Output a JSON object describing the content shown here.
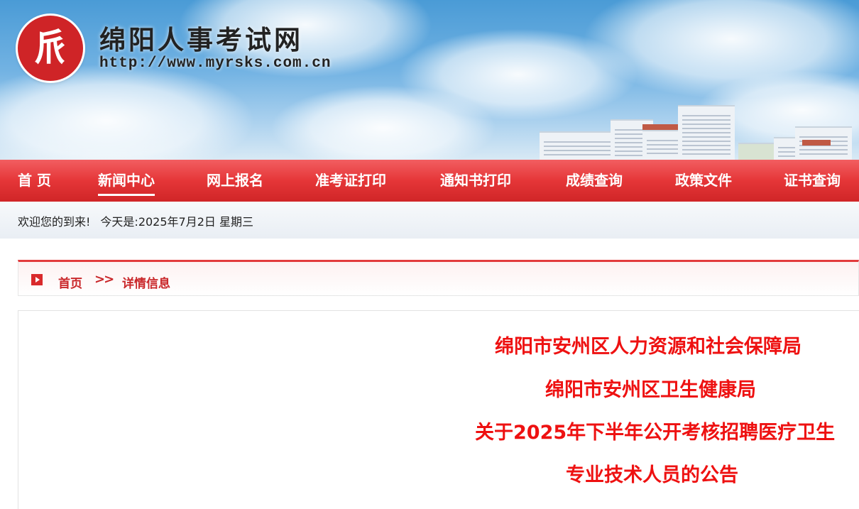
{
  "header": {
    "logo_glyph": "𠂢",
    "site_title": "绵阳人事考试网",
    "site_url": "http://www.myrsks.com.cn",
    "brand_color": "#cf2427"
  },
  "nav": {
    "items": [
      {
        "label": "首 页"
      },
      {
        "label": "新闻中心",
        "active": true
      },
      {
        "label": "网上报名"
      },
      {
        "label": "准考证打印"
      },
      {
        "label": "通知书打印"
      },
      {
        "label": "成绩查询"
      },
      {
        "label": "政策文件"
      },
      {
        "label": "证书查询"
      }
    ],
    "bar_color": "#e53638"
  },
  "welcome": {
    "greeting": "欢迎您的到来!",
    "date_text": "今天是:2025年7月2日 星期三"
  },
  "breadcrumb": {
    "home": "首页",
    "separator": ">>",
    "current": "详情信息"
  },
  "article": {
    "title_lines": [
      "绵阳市安州区人力资源和社会保障局",
      "绵阳市安州区卫生健康局",
      "关于2025年下半年公开考核招聘医疗卫生",
      "专业技术人员的公告"
    ],
    "title_color": "#ee1111"
  }
}
